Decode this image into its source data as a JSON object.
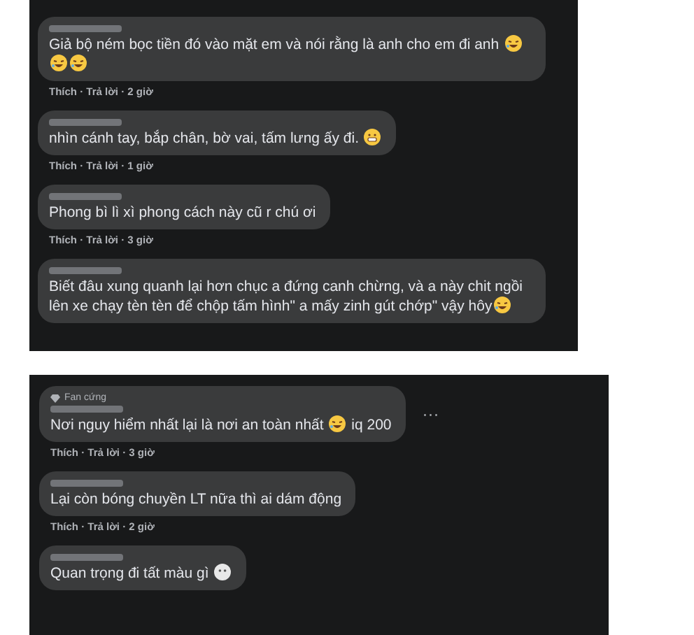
{
  "panels": [
    {
      "comments": [
        {
          "parts": [
            {
              "kind": "text",
              "text": "Giả bộ ném bọc tiền đó vào mặt em và nói rằng là anh cho em đi anh "
            },
            {
              "kind": "laugh"
            },
            {
              "kind": "laugh"
            },
            {
              "kind": "laugh"
            }
          ],
          "actions": "Thích · Trả lời · 2 giờ"
        },
        {
          "parts": [
            {
              "kind": "text",
              "text": "nhìn cánh tay, bắp chân, bờ vai, tấm lưng ấy đi. "
            },
            {
              "kind": "grin"
            }
          ],
          "actions": "Thích · Trả lời · 1 giờ"
        },
        {
          "parts": [
            {
              "kind": "text",
              "text": "Phong bì lì xì phong cách này cũ r chú ơi"
            }
          ],
          "actions": "Thích · Trả lời · 3 giờ"
        },
        {
          "parts": [
            {
              "kind": "text",
              "text": "Biết đâu xung quanh lại hơn chục a đứng canh chừng, và a này chit ngồi lên xe chạy tèn tèn để chộp tấm hình\" a mấy zinh gút chớp\" vậy hôy"
            },
            {
              "kind": "laugh"
            }
          ]
        }
      ]
    },
    {
      "comments": [
        {
          "badge": "Fan cứng",
          "parts": [
            {
              "kind": "text",
              "text": "Nơi nguy hiểm nhất lại là nơi an toàn nhất "
            },
            {
              "kind": "laugh"
            },
            {
              "kind": "text",
              "text": " iq 200"
            }
          ],
          "actions": "Thích · Trả lời · 3 giờ",
          "menu": "···"
        },
        {
          "parts": [
            {
              "kind": "text",
              "text": "Lại còn bóng chuyền LT nữa thì ai dám động"
            }
          ],
          "actions": "Thích · Trả lời · 2 giờ"
        },
        {
          "parts": [
            {
              "kind": "text",
              "text": "Quan trọng đi tất màu gì "
            },
            {
              "kind": "blank"
            }
          ]
        }
      ]
    }
  ]
}
